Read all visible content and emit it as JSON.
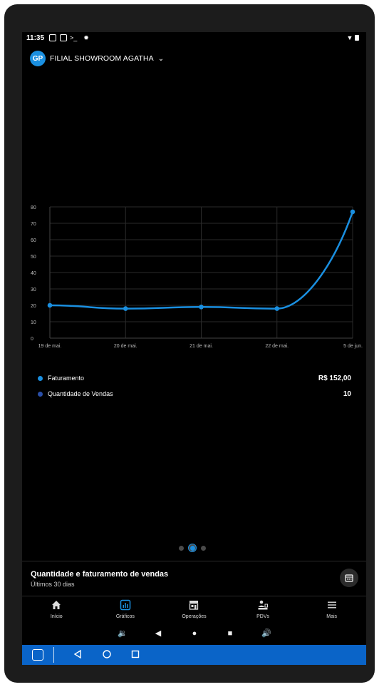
{
  "status_bar": {
    "time": "11:35"
  },
  "header": {
    "store_name": "FILIAL SHOWROOM AGATHA",
    "logo_text": "GP"
  },
  "chart_data": {
    "type": "line",
    "categories": [
      "19 de mai.",
      "20 de mai.",
      "21 de mai.",
      "22 de mai.",
      "5 de jun."
    ],
    "series": [
      {
        "name": "Faturamento",
        "values": [
          20,
          18,
          19,
          18,
          77
        ],
        "color": "#1a8fe0"
      }
    ],
    "y_ticks": [
      "0",
      "10",
      "20",
      "30",
      "40",
      "50",
      "60",
      "70",
      "80"
    ],
    "ylim": [
      0,
      80
    ],
    "grid": true
  },
  "legend": [
    {
      "label": "Faturamento",
      "value": "R$ 152,00",
      "color": "#1a8fe0"
    },
    {
      "label": "Quantidade de Vendas",
      "value": "10",
      "color": "#2a4fa8"
    }
  ],
  "pager": {
    "active_index": 1,
    "count": 3
  },
  "card": {
    "title": "Quantidade e faturamento de vendas",
    "subtitle": "Últimos 30 dias",
    "icon": "calendar-icon"
  },
  "nav": [
    {
      "label": "Início",
      "icon": "home-icon"
    },
    {
      "label": "Gráficos",
      "icon": "chart-icon",
      "active": true
    },
    {
      "label": "Operações",
      "icon": "store-icon"
    },
    {
      "label": "PDVs",
      "icon": "pos-icon"
    },
    {
      "label": "Mais",
      "icon": "menu-icon"
    }
  ]
}
